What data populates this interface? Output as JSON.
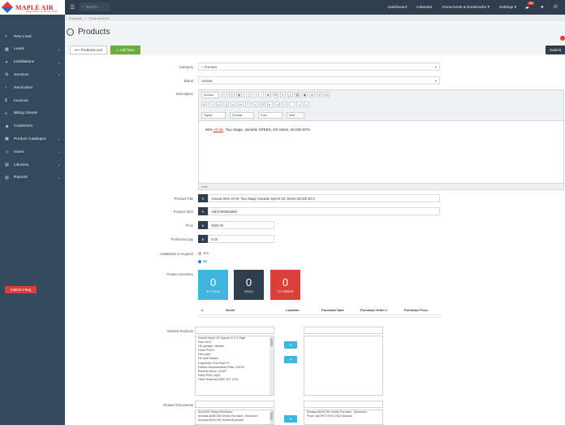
{
  "app": {
    "brand": "MAPLE AIR",
    "tagline": "HEATING & COOLING"
  },
  "topbar": {
    "search_placeholder": "Search...",
    "nav": [
      "Dashboard",
      "Calendar",
      "Documents & Bookmarks ▾",
      "Settings ▾"
    ],
    "notification_count": "99"
  },
  "sidebar": {
    "items": [
      {
        "label": "New Lead",
        "icon": "plus-icon",
        "chevron": false
      },
      {
        "label": "Leads",
        "icon": "grid-icon",
        "chevron": true
      },
      {
        "label": "Installations",
        "icon": "wrench-icon",
        "chevron": true
      },
      {
        "label": "Services",
        "icon": "cog-icon",
        "chevron": true
      },
      {
        "label": "Reminders",
        "icon": "bell-icon",
        "chevron": false
      },
      {
        "label": "Invoices",
        "icon": "dollar-icon",
        "chevron": false
      },
      {
        "label": "Billing Sheets",
        "icon": "list-icon",
        "chevron": false
      },
      {
        "label": "Customers",
        "icon": "users-icon",
        "chevron": false
      },
      {
        "label": "Product Catalogue",
        "icon": "box-icon",
        "chevron": true
      },
      {
        "label": "Users",
        "icon": "user-icon",
        "chevron": true
      },
      {
        "label": "Libraries",
        "icon": "book-icon",
        "chevron": true
      },
      {
        "label": "Reports",
        "icon": "chart-icon",
        "chevron": true
      }
    ],
    "bug_button": "Submit a Bug"
  },
  "breadcrumb": [
    "Products",
    "Products Edit"
  ],
  "header": {
    "title": "Products",
    "list_button": "Products List",
    "add_button": "Add New",
    "submit_button": "Submit"
  },
  "form": {
    "category_label": "Category",
    "category_value": "-- Furnace",
    "brand_label": "Brand",
    "brand_value": "Amana",
    "description_label": "Description",
    "editor": {
      "toolbar_row1": [
        "Source",
        "Styles",
        "Format",
        "Font",
        "Size"
      ],
      "content_prefix": "96% ",
      "content_ul": "AFUE",
      "content_suffix": ", Two Stage, Variable SPEED, DC Motor, 60,000 BTU",
      "footer": "body"
    },
    "title_label": "Product Title",
    "title_value": "Amana 96% AFUE Two Stage Variable Speed DC Motor 60,000 BTU",
    "sku_label": "Product SKU",
    "sku_value": "AMVC960604BN",
    "price_label": "Price",
    "price_value": "4500.00",
    "tech_label": "Technician pay",
    "tech_value": "0.00",
    "install_label": "Installation is required",
    "install_yes": "Yes",
    "install_no": "No",
    "inventory_label": "Product Inventory",
    "inventory": [
      {
        "count": "0",
        "caption": "IN STOCK",
        "color": "#3fb4dd"
      },
      {
        "count": "0",
        "caption": "HOLD",
        "color": "#2f3d4c"
      },
      {
        "count": "0",
        "caption": "TO ORDER",
        "color": "#d9403a"
      }
    ],
    "table_headers": [
      "#",
      "Serial",
      "Location",
      "Purchase Date",
      "Purchase Order #",
      "Purchase Price"
    ],
    "related_label": "Related Products",
    "related_options": [
      "Goose Neck 10 Square 4 X 9 High",
      "Flue Kit 2",
      "HD grease, Marten",
      "Hose Port 2",
      "New part",
      "Hi Limit Switch",
      "Capacitor Flue Pole 97",
      "Filtrete Replacement Filter 10X25",
      "Electric Motor 1/2HP",
      "HUM PRO 1540",
      "HUM Solenoid W/R 1KT 2/24"
    ],
    "related_docs_label": "Related Documents",
    "docs_left": [
      "AccURE Series Brochure",
      "Amana AMEC96 Series Furnace - Brochure",
      "Amana AMVC95 Series Brochure"
    ],
    "docs_right": [
      "Amana AMVC96 Series Furnace - Brochure",
      "Price List RST NOV 2015 Amana"
    ]
  }
}
